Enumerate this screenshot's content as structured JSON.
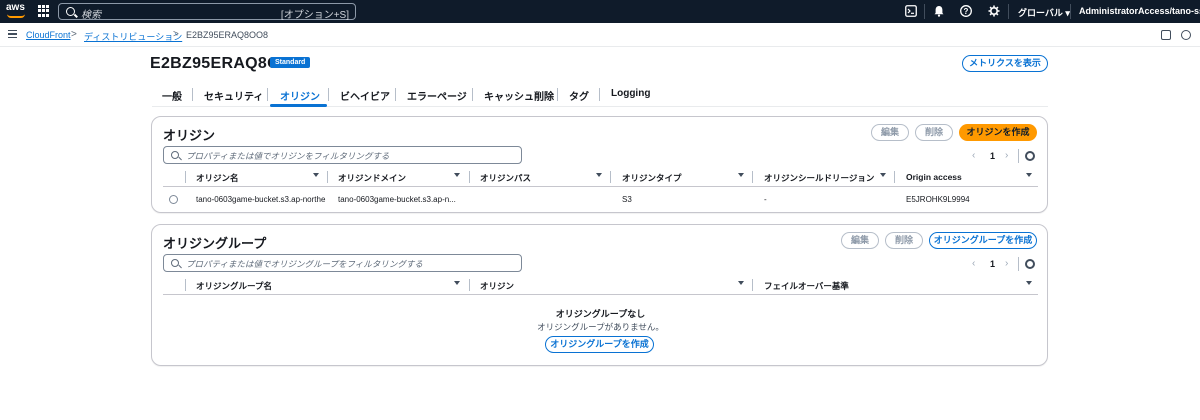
{
  "topnav": {
    "logo": "aws",
    "search_placeholder": "検索",
    "search_shortcut": "[オプション+S]",
    "region": "グローバル ▾",
    "account": "AdministratorAccess/tano-sso-user ▾",
    "icons": [
      "cloudshell-icon",
      "bell-icon",
      "help-icon",
      "gear-icon"
    ]
  },
  "breadcrumb": {
    "items": [
      "CloudFront",
      "ディストリビューション",
      "E2BZ95ERAQ8OO8"
    ],
    "separator": ">"
  },
  "header": {
    "title": "E2BZ95ERAQ8OO8",
    "badge": "Standard",
    "metrics_button": "メトリクスを表示"
  },
  "tabs": [
    {
      "label": "一般"
    },
    {
      "label": "セキュリティ"
    },
    {
      "label": "オリジン",
      "active": true
    },
    {
      "label": "ビヘイビア"
    },
    {
      "label": "エラーページ"
    },
    {
      "label": "キャッシュ削除"
    },
    {
      "label": "タグ"
    },
    {
      "label": "Logging"
    }
  ],
  "origins": {
    "title": "オリジン",
    "edit": "編集",
    "delete": "削除",
    "create": "オリジンを作成",
    "filter_placeholder": "プロパティまたは値でオリジンをフィルタリングする",
    "page": "1",
    "prev": "‹",
    "next": "›",
    "columns": [
      "オリジン名",
      "オリジンドメイン",
      "オリジンパス",
      "オリジンタイプ",
      "オリジンシールドリージョン",
      "Origin access"
    ],
    "rows": [
      {
        "name": "tano-0603game-bucket.s3.ap-northe",
        "domain": "tano-0603game-bucket.s3.ap-n...",
        "path": "",
        "type": "S3",
        "shield": "-",
        "access": "E5JROHK9L9994"
      }
    ]
  },
  "origin_groups": {
    "title": "オリジングループ",
    "edit": "編集",
    "delete": "削除",
    "create": "オリジングループを作成",
    "filter_placeholder": "プロパティまたは値でオリジングループをフィルタリングする",
    "page": "1",
    "prev": "‹",
    "next": "›",
    "columns": [
      "オリジングループ名",
      "オリジン",
      "フェイルオーバー基準"
    ],
    "empty_title": "オリジングループなし",
    "empty_sub": "オリジングループがありません。",
    "empty_create": "オリジングループを作成"
  },
  "colors": {
    "nav_bg": "#0f1b2a",
    "link": "#0972d3",
    "primary": "#ff9900"
  }
}
